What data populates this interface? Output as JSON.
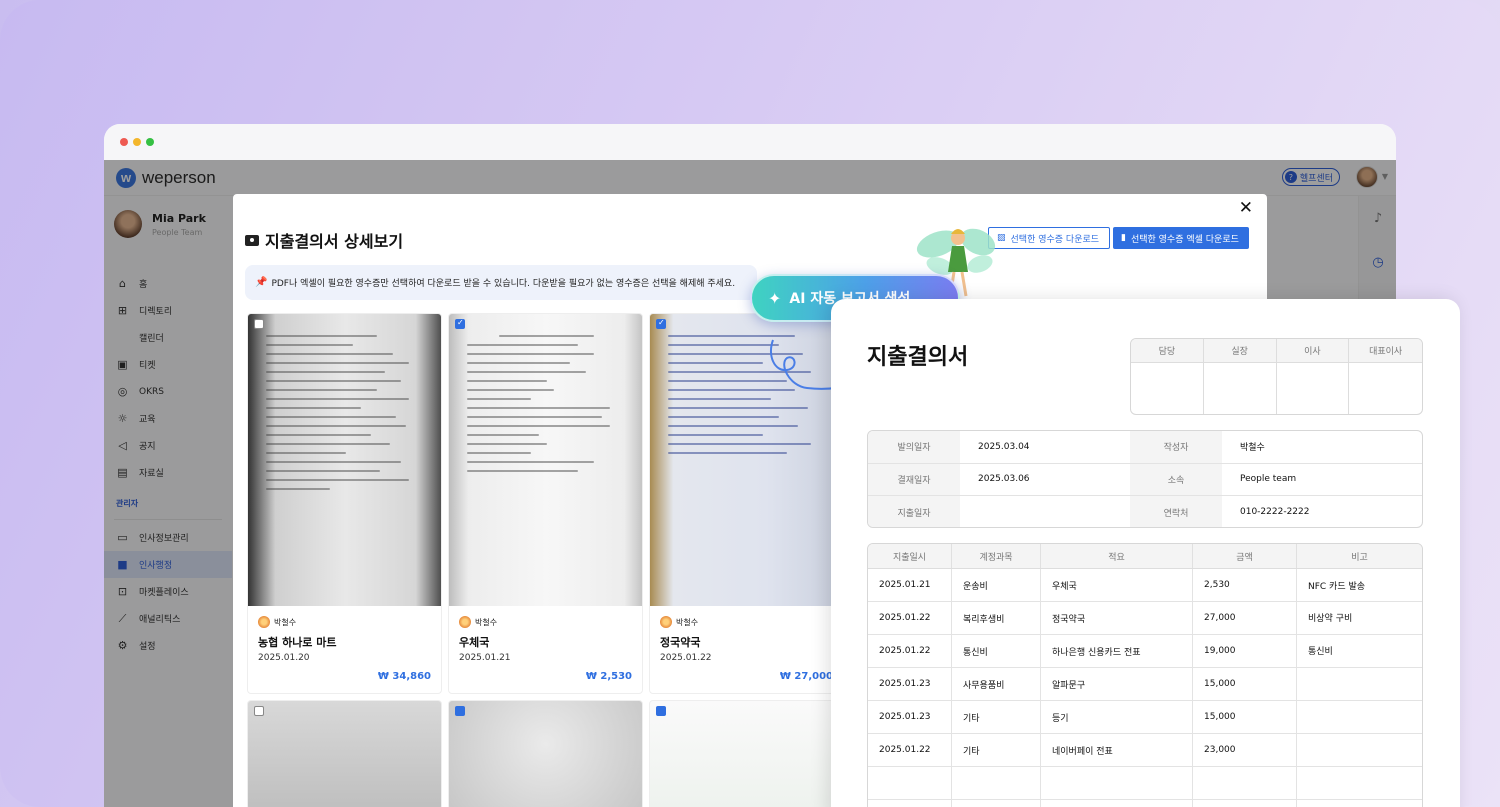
{
  "browser": {
    "dots": [
      "close",
      "minimize",
      "maximize"
    ]
  },
  "app": {
    "logo_text": "weperson",
    "help_label": "헬프센터",
    "profile": {
      "name": "Mia Park",
      "team": "People Team"
    },
    "menu": [
      {
        "icon": "home-icon",
        "label": "홈"
      },
      {
        "icon": "org-chart-icon",
        "label": "디렉토리"
      },
      {
        "icon": "",
        "label": "캘린더"
      },
      {
        "icon": "ticket-icon",
        "label": "티켓"
      },
      {
        "icon": "target-icon",
        "label": "OKRS"
      },
      {
        "icon": "lightbulb-icon",
        "label": "교육"
      },
      {
        "icon": "megaphone-icon",
        "label": "공지"
      },
      {
        "icon": "archive-icon",
        "label": "자료실"
      }
    ],
    "admin_section": "관리자",
    "admin_menu": [
      {
        "icon": "folder-person-icon",
        "label": "인사정보관리",
        "active": false
      },
      {
        "icon": "save-icon",
        "label": "인사행정",
        "active": true
      },
      {
        "icon": "gift-icon",
        "label": "마켓플레이스",
        "active": false
      },
      {
        "icon": "analytics-icon",
        "label": "애널리틱스",
        "active": false
      },
      {
        "icon": "gear-icon",
        "label": "설정",
        "active": false
      }
    ]
  },
  "modal": {
    "title": "지출결의서 상세보기",
    "download_receipts": "선택한 영수증 다운로드",
    "download_excel": "선택한 영수증 엑셀 다운로드",
    "notice": "PDF나 엑셀이 필요한 영수증만 선택하여 다운로드 받을 수 있습니다.  다운받을 필요가 없는 영수증은 선택을 해제해 주세요.",
    "cards": [
      {
        "author": "박철수",
        "store": "농협 하나로 마트",
        "date": "2025.01.20",
        "amount": "₩ 34,860",
        "checked": false
      },
      {
        "author": "박철수",
        "store": "우체국",
        "date": "2025.01.21",
        "amount": "₩ 2,530",
        "checked": true
      },
      {
        "author": "박철수",
        "store": "정국약국",
        "date": "2025.01.22",
        "amount": "₩ 27,000",
        "checked": true
      }
    ],
    "second_row_checked": [
      false,
      true,
      true
    ]
  },
  "ai_button": {
    "label": "AI 자동 보고서 생성"
  },
  "report": {
    "title": "지출결의서",
    "approval_headers": [
      "담당",
      "실장",
      "이사",
      "대표이사"
    ],
    "info": [
      {
        "k1": "발의일자",
        "v1": "2025.03.04",
        "k2": "작성자",
        "v2": "박철수"
      },
      {
        "k1": "결재일자",
        "v1": "2025.03.06",
        "k2": "소속",
        "v2": "People team"
      },
      {
        "k1": "지출일자",
        "v1": "",
        "k2": "연락처",
        "v2": "010-2222-2222"
      }
    ],
    "item_headers": [
      "지출일시",
      "계정과목",
      "적요",
      "금액",
      "비고"
    ],
    "items": [
      {
        "date": "2025.01.21",
        "account": "운송비",
        "desc": "우체국",
        "amount": "2,530",
        "note": "NFC 카드 발송"
      },
      {
        "date": "2025.01.22",
        "account": "복리후생비",
        "desc": "정국약국",
        "amount": "27,000",
        "note": "비상약 구비"
      },
      {
        "date": "2025.01.22",
        "account": "통신비",
        "desc": "하나은행 신용카드 전표",
        "amount": "19,000",
        "note": "통신비"
      },
      {
        "date": "2025.01.23",
        "account": "사무용품비",
        "desc": "알파문구",
        "amount": "15,000",
        "note": ""
      },
      {
        "date": "2025.01.23",
        "account": "기타",
        "desc": "등기",
        "amount": "15,000",
        "note": ""
      },
      {
        "date": "2025.01.22",
        "account": "기타",
        "desc": "네이버페이 전표",
        "amount": "23,000",
        "note": ""
      },
      {
        "date": "",
        "account": "",
        "desc": "",
        "amount": "",
        "note": ""
      },
      {
        "date": "",
        "account": "",
        "desc": "",
        "amount": "",
        "note": ""
      }
    ]
  }
}
